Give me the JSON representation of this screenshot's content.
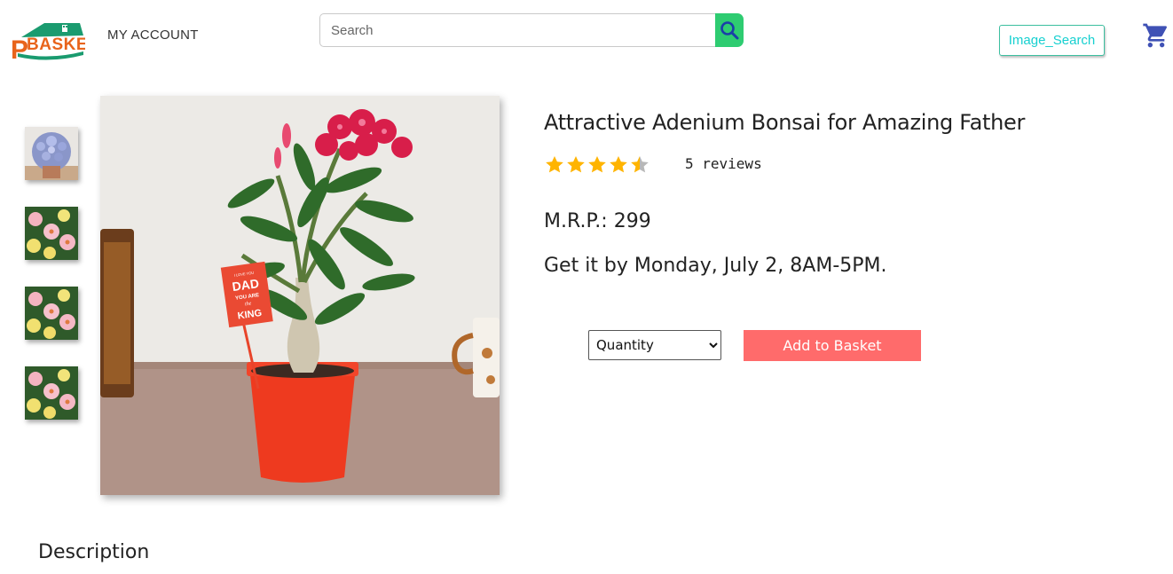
{
  "header": {
    "logo_text": "BASKET",
    "logo_letter": "P",
    "my_account": "MY ACCOUNT",
    "search_placeholder": "Search",
    "search_value": "",
    "image_search_label": "Image_Search"
  },
  "gallery": {
    "thumbnails": [
      {
        "alt": "blue-flower-pot-thumbnail"
      },
      {
        "alt": "pink-yellow-flowers-thumbnail"
      },
      {
        "alt": "pink-yellow-flowers-thumbnail"
      },
      {
        "alt": "pink-yellow-flowers-thumbnail"
      }
    ],
    "main_image_sign": {
      "line1": "I LOVE YOU",
      "line2": "DAD",
      "line3": "YOU ARE",
      "line4": "the",
      "line5": "KING"
    }
  },
  "product": {
    "title": "Attractive Adenium Bonsai for Amazing Father",
    "rating": 4.5,
    "rating_max": 5,
    "reviews": "5 reviews",
    "mrp": "M.R.P.: 299",
    "delivery": "Get it by Monday, July 2, 8AM-5PM.",
    "quantity_selected": "Quantity",
    "add_to_basket_label": "Add to Basket"
  },
  "description_heading": "Description",
  "colors": {
    "accent_green": "#2ecc71",
    "add_button": "#ff6b6b",
    "star": "#ffb400",
    "cart_icon": "#3f51b5",
    "image_search_text": "#16d0d0"
  },
  "icons": {
    "search": "search-icon",
    "cart": "cart-icon",
    "star": "star-icon"
  }
}
